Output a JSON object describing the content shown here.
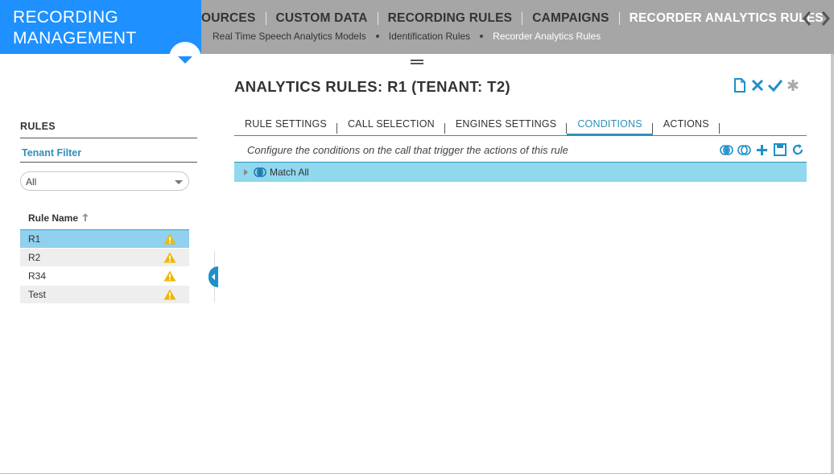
{
  "app": {
    "title_line1": "RECORDING",
    "title_line2": "MANAGEMENT"
  },
  "topnav": {
    "items": [
      {
        "label": "OURCES",
        "active": false
      },
      {
        "label": "CUSTOM DATA",
        "active": false
      },
      {
        "label": "RECORDING RULES",
        "active": false
      },
      {
        "label": "CAMPAIGNS",
        "active": false
      },
      {
        "label": "RECORDER ANALYTICS RULES",
        "active": true
      }
    ]
  },
  "breadcrumb": {
    "items": [
      "Real Time Speech Analytics Models",
      "Identification Rules",
      "Recorder Analytics Rules"
    ]
  },
  "sidebar": {
    "title": "RULES",
    "tenant_filter_label": "Tenant Filter",
    "tenant_filter_value": "All",
    "column_header": "Rule Name",
    "rules": [
      {
        "name": "R1",
        "selected": true,
        "warning": true
      },
      {
        "name": "R2",
        "selected": false,
        "warning": true
      },
      {
        "name": "R34",
        "selected": false,
        "warning": true
      },
      {
        "name": "Test",
        "selected": false,
        "warning": true
      }
    ]
  },
  "main": {
    "title": "ANALYTICS RULES: R1 (TENANT: T2)",
    "tabs": [
      {
        "label": "RULE SETTINGS",
        "active": false
      },
      {
        "label": "CALL SELECTION",
        "active": false
      },
      {
        "label": "ENGINES SETTINGS",
        "active": false
      },
      {
        "label": "CONDITIONS",
        "active": true
      },
      {
        "label": "ACTIONS",
        "active": false
      }
    ],
    "conditions_description": "Configure the conditions on the call that trigger the actions of this rule",
    "tree_root_label": "Match All"
  },
  "colors": {
    "brand_blue": "#1e90ff",
    "header_gray": "#a6a6a6",
    "accent_teal": "#2f8fb8",
    "selection_blue": "#8fd1ee",
    "warning_yellow": "#f2b705"
  },
  "icons": {
    "title_actions": [
      "new-document-icon",
      "close-icon",
      "checkmark-icon",
      "asterisk-icon"
    ],
    "condition_tools": [
      "match-all-icon",
      "match-any-icon",
      "add-icon",
      "save-icon",
      "refresh-icon"
    ]
  }
}
